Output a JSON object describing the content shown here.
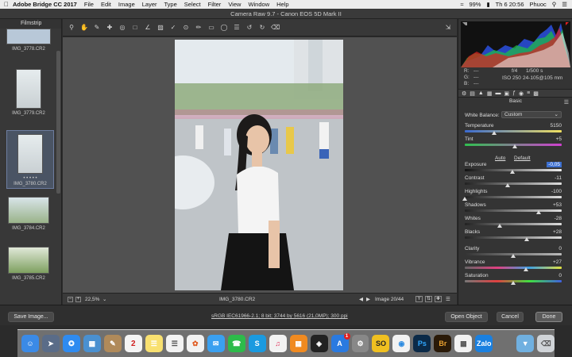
{
  "menubar": {
    "app_name": "Adobe Bridge CC 2017",
    "items": [
      "File",
      "Edit",
      "Image",
      "Layer",
      "Type",
      "Select",
      "Filter",
      "View",
      "Window",
      "Help"
    ],
    "battery": "99%",
    "clock": "Th 6 20:56",
    "user": "Phuoc"
  },
  "window": {
    "title": "Camera Raw 9.7  -  Canon EOS 5D Mark II"
  },
  "filmstrip": {
    "title": "Filmstrip",
    "items": [
      {
        "name": "IMG_3778.CR2"
      },
      {
        "name": "IMG_3779.CR2"
      },
      {
        "name": "IMG_3780.CR2"
      },
      {
        "name": "IMG_3784.CR2"
      },
      {
        "name": "IMG_3785.CR2"
      }
    ],
    "rating_dots": "• • • • •"
  },
  "status": {
    "zoom": "22,5%",
    "filename": "IMG_3780.CR2",
    "image_index": "Image 20/44"
  },
  "histogram": {
    "r_label": "R:",
    "g_label": "G:",
    "b_label": "B:",
    "r_value": "---",
    "g_value": "---",
    "b_value": "---",
    "aperture": "f/4",
    "shutter": "1/500 s",
    "iso": "ISO 250",
    "lens": "24-105@105 mm"
  },
  "basic": {
    "title": "Basic",
    "white_balance_label": "White Balance:",
    "white_balance_value": "Custom",
    "auto_label": "Auto",
    "default_label": "Default",
    "sliders": [
      {
        "label": "Temperature",
        "value": "5150",
        "level": 0.3
      },
      {
        "label": "Tint",
        "value": "+5",
        "level": 0.52
      },
      {
        "label": "Exposure",
        "value": "-0,05",
        "level": 0.49
      },
      {
        "label": "Contrast",
        "value": "-11",
        "level": 0.44
      },
      {
        "label": "Highlights",
        "value": "-100",
        "level": 0.0
      },
      {
        "label": "Shadows",
        "value": "+53",
        "level": 0.76
      },
      {
        "label": "Whites",
        "value": "-28",
        "level": 0.36
      },
      {
        "label": "Blacks",
        "value": "+28",
        "level": 0.64
      },
      {
        "label": "Clarity",
        "value": "0",
        "level": 0.5
      },
      {
        "label": "Vibrance",
        "value": "+27",
        "level": 0.63
      },
      {
        "label": "Saturation",
        "value": "0",
        "level": 0.5
      }
    ]
  },
  "bottom": {
    "save_label": "Save Image...",
    "workflow_link": "sRGB IEC61966-2.1; 8 bit; 3744 by 5616 (21,0MP); 300 ppi",
    "open_label": "Open Object",
    "cancel_label": "Cancel",
    "done_label": "Done"
  },
  "dock": {
    "calendar_day": "2",
    "badge": "1"
  },
  "colors": {
    "accent_selected": "#4a5464",
    "exposure_highlight": "#3c6fd0"
  }
}
